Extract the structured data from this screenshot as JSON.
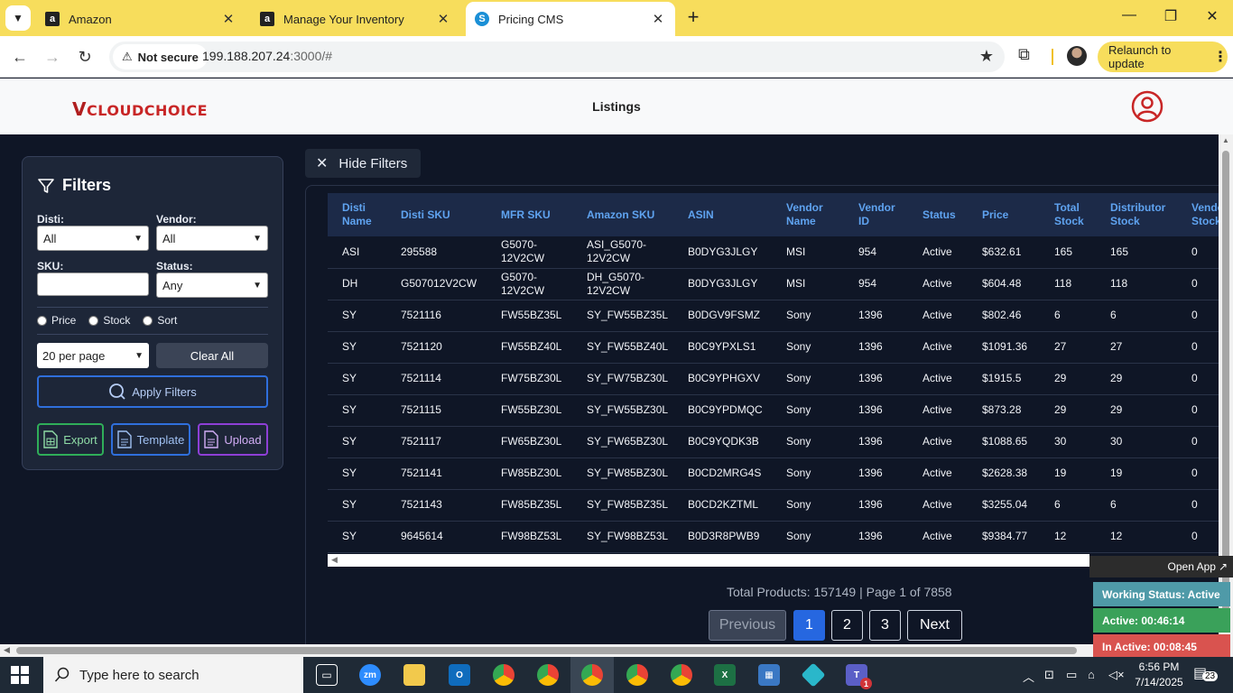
{
  "browser": {
    "tabs": [
      {
        "title": "Amazon",
        "favicon": "a"
      },
      {
        "title": "Manage Your Inventory",
        "favicon": "a"
      },
      {
        "title": "Pricing CMS",
        "favicon": "S"
      }
    ],
    "security_label": "Not secure",
    "url_host": "199.188.207.24",
    "url_path": ":3000/#",
    "relaunch_label": "Relaunch to update"
  },
  "header": {
    "logo_text": "CLOUDCHOICE",
    "logo_initial": "V",
    "title": "Listings"
  },
  "filters": {
    "title": "Filters",
    "disti_label": "Disti:",
    "disti_value": "All",
    "vendor_label": "Vendor:",
    "vendor_value": "All",
    "sku_label": "SKU:",
    "sku_value": "",
    "status_label": "Status:",
    "status_value": "Any",
    "radio_price": "Price",
    "radio_stock": "Stock",
    "radio_sort": "Sort",
    "per_page": "20 per page",
    "clear_all": "Clear All",
    "apply": "Apply Filters",
    "export": "Export",
    "template": "Template",
    "upload": "Upload"
  },
  "hide_filters_label": "Hide Filters",
  "table": {
    "columns": [
      "Disti Name",
      "Disti SKU",
      "MFR SKU",
      "Amazon SKU",
      "ASIN",
      "Vendor Name",
      "Vendor ID",
      "Status",
      "Price",
      "Total Stock",
      "Distributor Stock",
      "Vendor Stock"
    ],
    "rows": [
      [
        "ASI",
        "295588",
        "G5070-12V2CW",
        "ASI_G5070-12V2CW",
        "B0DYG3JLGY",
        "MSI",
        "954",
        "Active",
        "$632.61",
        "165",
        "165",
        "0"
      ],
      [
        "DH",
        "G507012V2CW",
        "G5070-12V2CW",
        "DH_G5070-12V2CW",
        "B0DYG3JLGY",
        "MSI",
        "954",
        "Active",
        "$604.48",
        "118",
        "118",
        "0"
      ],
      [
        "SY",
        "7521116",
        "FW55BZ35L",
        "SY_FW55BZ35L",
        "B0DGV9FSMZ",
        "Sony",
        "1396",
        "Active",
        "$802.46",
        "6",
        "6",
        "0"
      ],
      [
        "SY",
        "7521120",
        "FW55BZ40L",
        "SY_FW55BZ40L",
        "B0C9YPXLS1",
        "Sony",
        "1396",
        "Active",
        "$1091.36",
        "27",
        "27",
        "0"
      ],
      [
        "SY",
        "7521114",
        "FW75BZ30L",
        "SY_FW75BZ30L",
        "B0C9YPHGXV",
        "Sony",
        "1396",
        "Active",
        "$1915.5",
        "29",
        "29",
        "0"
      ],
      [
        "SY",
        "7521115",
        "FW55BZ30L",
        "SY_FW55BZ30L",
        "B0C9YPDMQC",
        "Sony",
        "1396",
        "Active",
        "$873.28",
        "29",
        "29",
        "0"
      ],
      [
        "SY",
        "7521117",
        "FW65BZ30L",
        "SY_FW65BZ30L",
        "B0C9YQDK3B",
        "Sony",
        "1396",
        "Active",
        "$1088.65",
        "30",
        "30",
        "0"
      ],
      [
        "SY",
        "7521141",
        "FW85BZ30L",
        "SY_FW85BZ30L",
        "B0CD2MRG4S",
        "Sony",
        "1396",
        "Active",
        "$2628.38",
        "19",
        "19",
        "0"
      ],
      [
        "SY",
        "7521143",
        "FW85BZ35L",
        "SY_FW85BZ35L",
        "B0CD2KZTML",
        "Sony",
        "1396",
        "Active",
        "$3255.04",
        "6",
        "6",
        "0"
      ],
      [
        "SY",
        "9645614",
        "FW98BZ53L",
        "SY_FW98BZ53L",
        "B0D3R8PWB9",
        "Sony",
        "1396",
        "Active",
        "$9384.77",
        "12",
        "12",
        "0"
      ]
    ]
  },
  "pagination": {
    "summary": "Total Products: 157149 | Page 1 of 7858",
    "previous": "Previous",
    "pages": [
      "1",
      "2",
      "3"
    ],
    "next": "Next"
  },
  "status_widget": {
    "open_app": "Open App",
    "working_status": "Working Status: Active",
    "active": "Active: 00:46:14",
    "inactive": "In Active: 00:08:45"
  },
  "taskbar": {
    "search_placeholder": "Type here to search",
    "time": "6:56 PM",
    "date": "7/14/2025",
    "notification_count": "23",
    "teams_badge": "1"
  },
  "colors": {
    "page_bg": "#0f1626",
    "panel_bg": "#1d2638",
    "header_text": "#5fa3f0",
    "primary": "#2667e0",
    "tab_strip": "#f7dd5c"
  }
}
